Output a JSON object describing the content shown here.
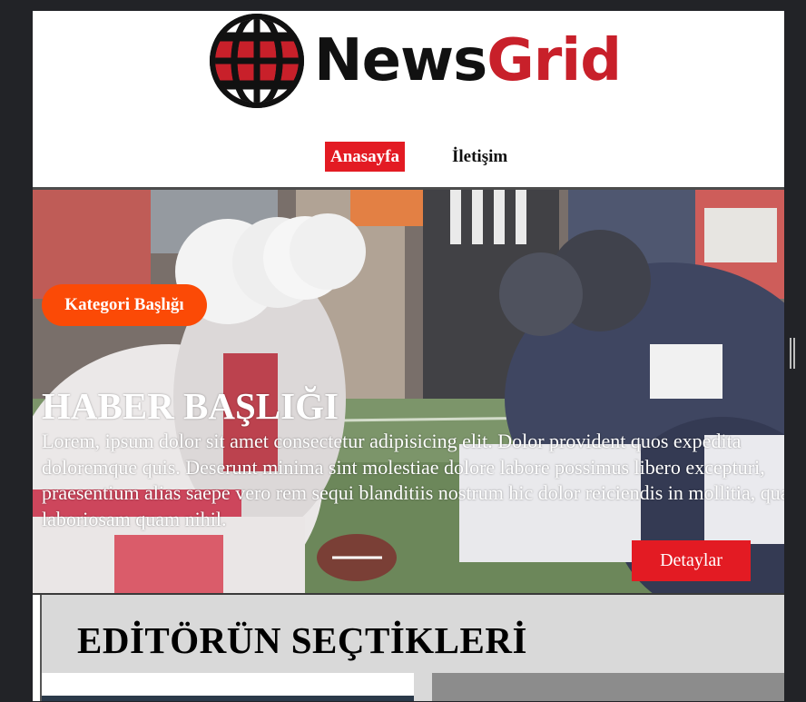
{
  "brand": {
    "name_part1": "News",
    "name_part2": "Grid",
    "logo_icon": "globe-icon",
    "colors": {
      "dark": "#111111",
      "accent": "#c8202a"
    }
  },
  "nav": {
    "items": [
      {
        "label": "Anasayfa",
        "active": true
      },
      {
        "label": "İletişim",
        "active": false
      }
    ]
  },
  "hero": {
    "category": "Kategori Başlığı",
    "title": "HABER BAŞLIĞI",
    "text": "Lorem, ipsum dolor sit amet consectetur adipisicing elit. Dolor provident quos expedita doloremque quis. Deserunt minima sint molestiae dolore labore possimus libero excepturi, praesentium alias saepe vero rem sequi blanditiis nostrum hic dolor reiciendis in mollitia, quas laboriosam quam nihil.",
    "button_label": "Detaylar",
    "colors": {
      "badge": "#fb4a06",
      "button": "#e31b23"
    }
  },
  "editors": {
    "title": "EDİTÖRÜN SEÇTİKLERİ"
  }
}
